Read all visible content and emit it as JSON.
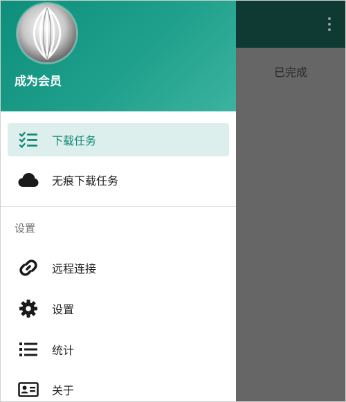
{
  "main": {
    "status_label": "已完成"
  },
  "drawer": {
    "header": {
      "vip_label": "成为会员"
    },
    "items": [
      {
        "label": "下载任务",
        "icon": "task-list-icon",
        "active": true
      },
      {
        "label": "无痕下载任务",
        "icon": "cloud-icon",
        "active": false
      }
    ],
    "section_title": "设置",
    "settings_items": [
      {
        "label": "远程连接",
        "icon": "link-icon"
      },
      {
        "label": "设置",
        "icon": "gear-icon"
      },
      {
        "label": "统计",
        "icon": "list-icon"
      },
      {
        "label": "关于",
        "icon": "id-card-icon"
      }
    ]
  },
  "colors": {
    "accent": "#12897a",
    "header_gradient_start": "#0d8f7c",
    "header_gradient_end": "#3bb3a0",
    "active_bg": "#dcefec",
    "main_bar": "#0f3a34",
    "scrim": "#666666"
  }
}
